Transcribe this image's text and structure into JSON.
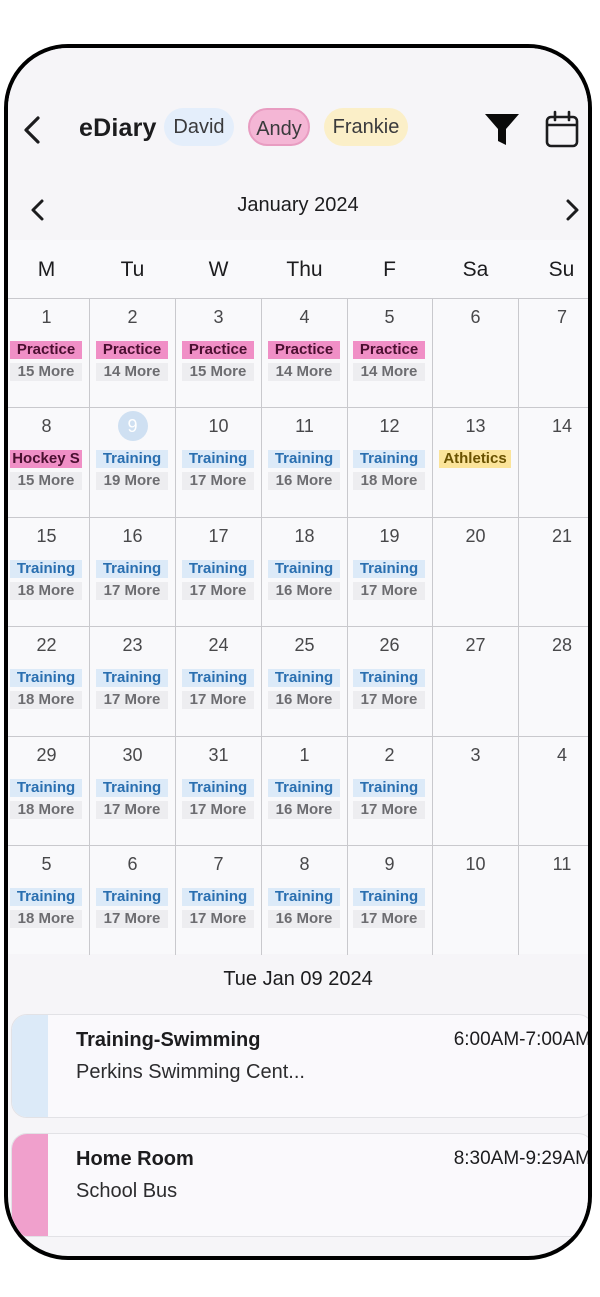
{
  "header": {
    "title": "eDiary",
    "children": [
      "David",
      "Andy",
      "Frankie"
    ],
    "icons": {
      "back": "chevron-left-icon",
      "filter": "filter-icon",
      "calendar": "calendar-icon"
    }
  },
  "calendar": {
    "month_label": "January 2024",
    "weekdays": [
      "M",
      "Tu",
      "W",
      "Thu",
      "F",
      "Sa",
      "Su"
    ],
    "weeks": [
      [
        {
          "day": "1",
          "event": "Practice",
          "type": "pink",
          "more": "15 More"
        },
        {
          "day": "2",
          "event": "Practice",
          "type": "pink",
          "more": "14 More"
        },
        {
          "day": "3",
          "event": "Practice",
          "type": "pink",
          "more": "15 More"
        },
        {
          "day": "4",
          "event": "Practice",
          "type": "pink",
          "more": "14 More"
        },
        {
          "day": "5",
          "event": "Practice",
          "type": "pink",
          "more": "14 More"
        },
        {
          "day": "6"
        },
        {
          "day": "7"
        }
      ],
      [
        {
          "day": "8",
          "event": "Hockey S",
          "type": "pink",
          "more": "15 More"
        },
        {
          "day": "9",
          "today": true,
          "event": "Training",
          "type": "blue",
          "more": "19 More"
        },
        {
          "day": "10",
          "event": "Training",
          "type": "blue",
          "more": "17 More"
        },
        {
          "day": "11",
          "event": "Training",
          "type": "blue",
          "more": "16 More"
        },
        {
          "day": "12",
          "event": "Training",
          "type": "blue",
          "more": "18 More"
        },
        {
          "day": "13",
          "event": "Athletics",
          "type": "yellow"
        },
        {
          "day": "14"
        }
      ],
      [
        {
          "day": "15",
          "event": "Training",
          "type": "blue",
          "more": "18 More"
        },
        {
          "day": "16",
          "event": "Training",
          "type": "blue",
          "more": "17 More"
        },
        {
          "day": "17",
          "event": "Training",
          "type": "blue",
          "more": "17 More"
        },
        {
          "day": "18",
          "event": "Training",
          "type": "blue",
          "more": "16 More"
        },
        {
          "day": "19",
          "event": "Training",
          "type": "blue",
          "more": "17 More"
        },
        {
          "day": "20"
        },
        {
          "day": "21"
        }
      ],
      [
        {
          "day": "22",
          "event": "Training",
          "type": "blue",
          "more": "18 More"
        },
        {
          "day": "23",
          "event": "Training",
          "type": "blue",
          "more": "17 More"
        },
        {
          "day": "24",
          "event": "Training",
          "type": "blue",
          "more": "17 More"
        },
        {
          "day": "25",
          "event": "Training",
          "type": "blue",
          "more": "16 More"
        },
        {
          "day": "26",
          "event": "Training",
          "type": "blue",
          "more": "17 More"
        },
        {
          "day": "27"
        },
        {
          "day": "28"
        }
      ],
      [
        {
          "day": "29",
          "event": "Training",
          "type": "blue",
          "more": "18 More"
        },
        {
          "day": "30",
          "event": "Training",
          "type": "blue",
          "more": "17 More"
        },
        {
          "day": "31",
          "event": "Training",
          "type": "blue",
          "more": "17 More"
        },
        {
          "day": "1",
          "event": "Training",
          "type": "blue",
          "more": "16 More"
        },
        {
          "day": "2",
          "event": "Training",
          "type": "blue",
          "more": "17 More"
        },
        {
          "day": "3"
        },
        {
          "day": "4"
        }
      ],
      [
        {
          "day": "5",
          "event": "Training",
          "type": "blue",
          "more": "18 More"
        },
        {
          "day": "6",
          "event": "Training",
          "type": "blue",
          "more": "17 More"
        },
        {
          "day": "7",
          "event": "Training",
          "type": "blue",
          "more": "17 More"
        },
        {
          "day": "8",
          "event": "Training",
          "type": "blue",
          "more": "16 More"
        },
        {
          "day": "9",
          "event": "Training",
          "type": "blue",
          "more": "17 More"
        },
        {
          "day": "10"
        },
        {
          "day": "11"
        }
      ]
    ]
  },
  "selected_day": {
    "label": "Tue Jan 09 2024",
    "events": [
      {
        "title": "Training-Swimming",
        "location": "Perkins Swimming Cent...",
        "time": "6:00AM-7:00AM",
        "color": "#dceaf8"
      },
      {
        "title": "Home Room",
        "location": "School Bus",
        "time": "8:30AM-9:29AM",
        "color": "#f0a0cc"
      }
    ]
  },
  "colors": {
    "andy": "#f4b6d5",
    "david": "#e4eefb",
    "frankie": "#fbefc8",
    "today": "#cfe0f2"
  }
}
